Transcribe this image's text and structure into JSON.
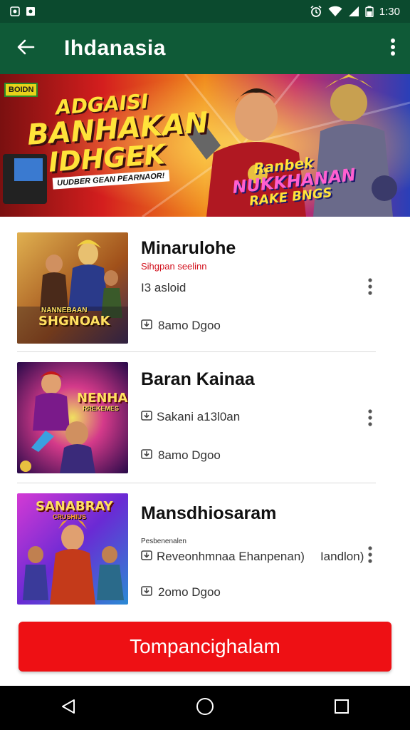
{
  "status": {
    "time": "1:30",
    "left_icons": [
      "notification-icon",
      "notification-icon"
    ],
    "right_icons": [
      "alarm-icon",
      "wifi-icon",
      "signal-icon",
      "battery-icon"
    ]
  },
  "appbar": {
    "title": "Ihdanasia",
    "back_icon": "arrow-left-icon",
    "menu_icon": "more-vert-icon"
  },
  "banner": {
    "badge": "BOIDN",
    "line1": "ADGAISI",
    "line2": "BANHAKAN",
    "line3": "IDHGEK",
    "tagline": "UUDBER GEAN PEARNAOR!",
    "promo_line1": "Ranbek",
    "promo_line2": "NUKKHANAN",
    "promo_line3": "RAKE BNGS",
    "colors": {
      "left": "#d41e1e",
      "mid": "#f08a1c",
      "right": "#2a3fb8"
    }
  },
  "items": [
    {
      "title": "Minarulohe",
      "subtitle": "Sihgpan seelinn",
      "description": "I3 asloid",
      "meta": "8amo  Dgoo",
      "thumb_caption": "SHGNOAK",
      "thumb_caption_top": "NANNEBAAN",
      "thumb_colors": [
        "#c98a2a",
        "#3b2a55"
      ]
    },
    {
      "title": "Baran Kainaa",
      "subtitle": "",
      "description": "Sakani a13l0an",
      "meta": "8amo  Dgoo",
      "thumb_caption": "NENHAN",
      "thumb_caption_top": "RREKEMES",
      "thumb_colors": [
        "#5a1a8a",
        "#d43a2a"
      ]
    },
    {
      "title": "Mansdhiosaram",
      "subtitle": "",
      "tiny_label": "Pesbenenalen",
      "description": "Reveonhmnaa Ehanpenan)",
      "description_extra": "Iandlon)",
      "meta": "2omo  Dgoo",
      "thumb_caption": "SANABRAY",
      "thumb_caption_top": "CRUSHIUS",
      "thumb_colors": [
        "#8a2ad4",
        "#2a8ad4"
      ]
    }
  ],
  "cta": {
    "label": "Tompancighalam",
    "color": "#ee1014"
  },
  "nav": {
    "back_icon": "triangle-back-icon",
    "home_icon": "circle-home-icon",
    "recents_icon": "square-recents-icon"
  }
}
